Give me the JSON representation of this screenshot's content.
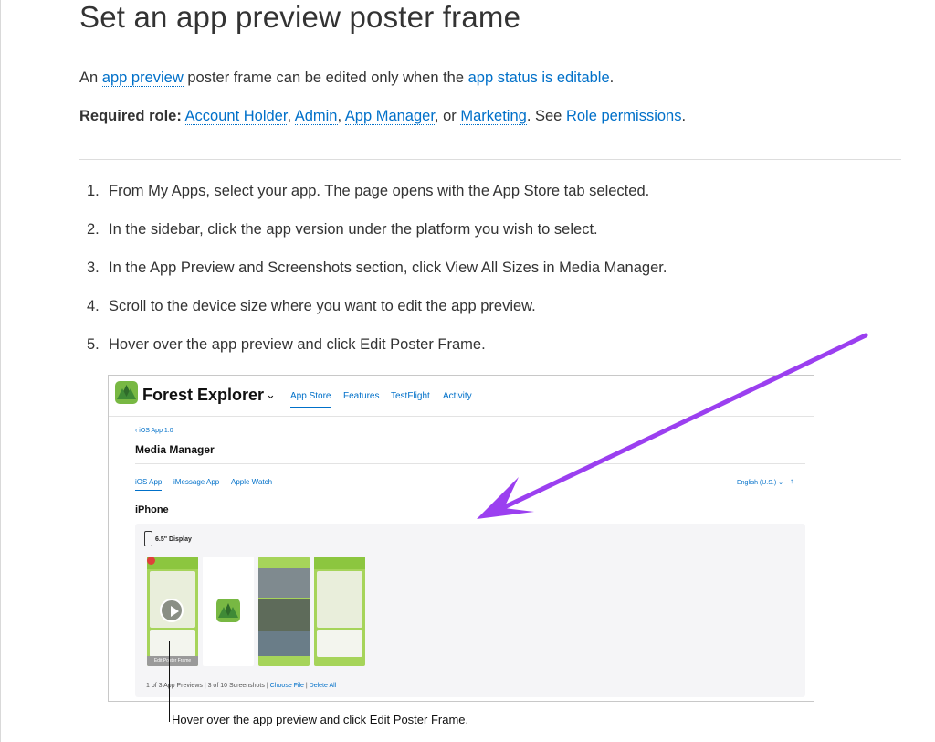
{
  "title": "Set an app preview poster frame",
  "intro": {
    "t1": "An ",
    "link1": "app preview",
    "t2": " poster frame can be edited only when the ",
    "link2": "app status is editable",
    "t3": "."
  },
  "role": {
    "label": "Required role:",
    "r1": "Account Holder",
    "c1": ", ",
    "r2": "Admin",
    "c2": ", ",
    "r3": "App Manager",
    "c3": ", or ",
    "r4": "Marketing",
    "t": ". See ",
    "perm": "Role permissions",
    "end": "."
  },
  "steps": [
    {
      "n": "1.",
      "text": "From My Apps, select your app. The page opens with the App Store tab selected."
    },
    {
      "n": "2.",
      "text": "In the sidebar, click the app version under the platform you wish to select."
    },
    {
      "n": "3.",
      "text": "In the App Preview and Screenshots section, click View All Sizes in Media Manager."
    },
    {
      "n": "4.",
      "text": "Scroll to the device size where you want to edit the app preview."
    },
    {
      "n": "5.",
      "text": "Hover over the app preview and click Edit Poster Frame."
    }
  ],
  "screenshot": {
    "app_name": "Forest Explorer",
    "chevron": "⌄",
    "nav": [
      "App Store",
      "Features",
      "TestFlight",
      "Activity"
    ],
    "breadcrumb": "‹ iOS App 1.0",
    "page_title": "Media Manager",
    "tabs": [
      "iOS App",
      "iMessage App",
      "Apple Watch"
    ],
    "language": "English (U.S.) ⌄",
    "upload_icon": "↑",
    "section": "iPhone",
    "display": "6.5\" Display",
    "edit_poster": "Edit Poster Frame",
    "footer": {
      "previews": "1 of 3 App Previews",
      "screenshots": "3 of 10 Screenshots",
      "choose": "Choose File",
      "delete": "Delete All"
    }
  },
  "caption": "Hover over the app preview and click Edit Poster Frame.",
  "colors": {
    "link": "#0070c9",
    "arrow": "#9b3ff0",
    "app_green": "#78b843"
  }
}
